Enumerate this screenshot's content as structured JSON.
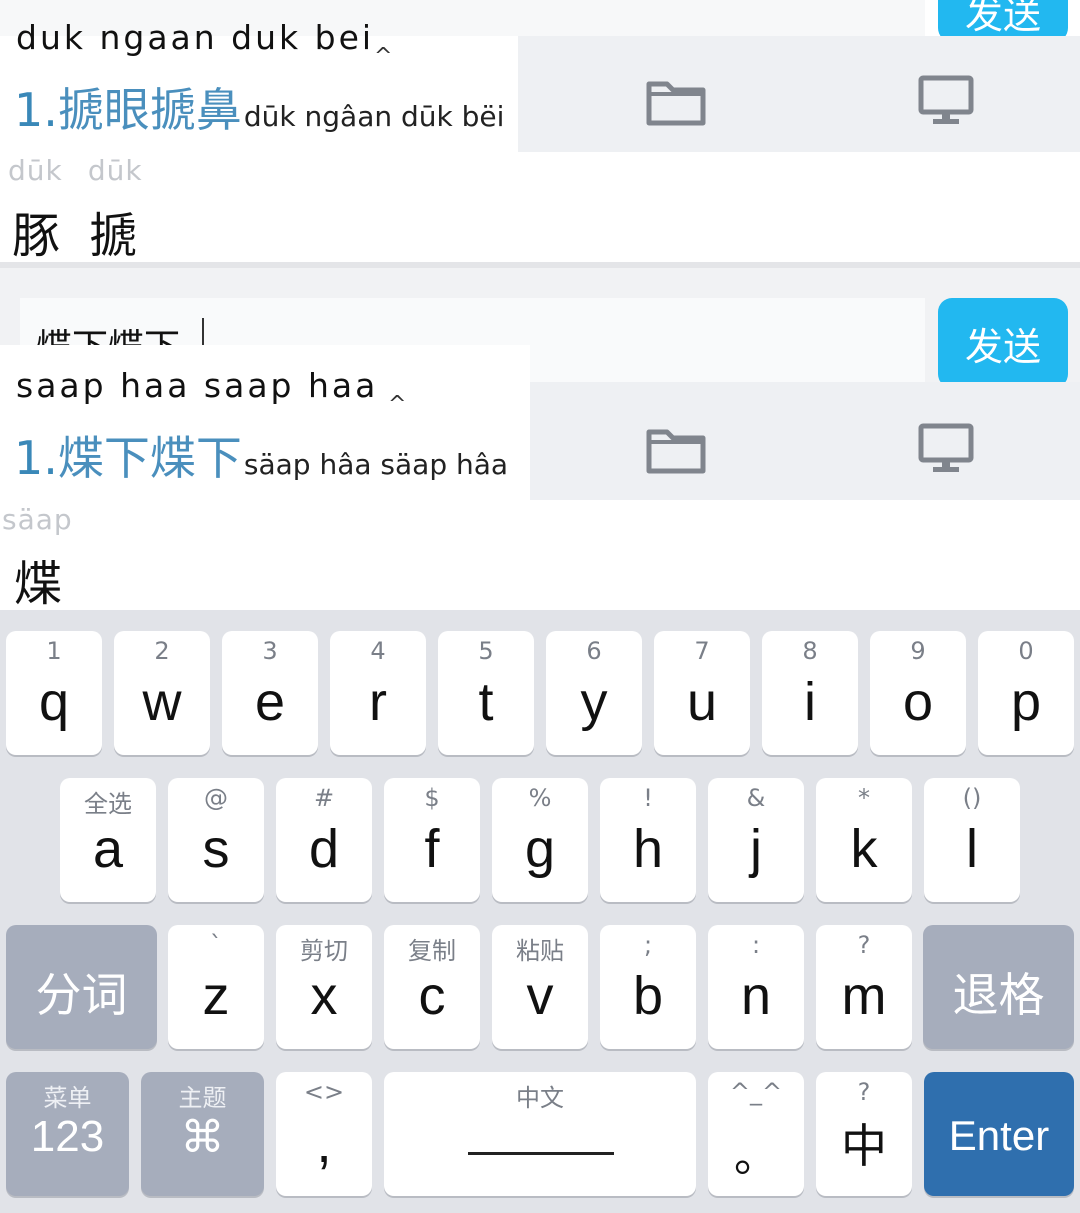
{
  "panel1": {
    "send_label": "发送",
    "composition": "duk ngaan duk bei",
    "caret": "^",
    "candidate_number": "1.",
    "candidate_chars": "搋眼搋鼻",
    "candidate_roman": "dūk ngâan dūk bëi",
    "tones": [
      "dūk",
      "dūk"
    ],
    "chars": [
      "豚",
      "搋"
    ]
  },
  "panel2": {
    "input_text": "煠下煠下",
    "send_label": "发送",
    "composition": "saap haa saap haa",
    "caret": "^",
    "candidate_number": "1.",
    "candidate_chars": "煠下煠下",
    "candidate_roman": "säap hâa säap hâa",
    "tones": [
      "säap"
    ],
    "chars": [
      "煠"
    ]
  },
  "icons": [
    "folder-icon",
    "monitor-icon"
  ],
  "keyboard": {
    "row1": [
      {
        "sec": "1",
        "pri": "q"
      },
      {
        "sec": "2",
        "pri": "w"
      },
      {
        "sec": "3",
        "pri": "e"
      },
      {
        "sec": "4",
        "pri": "r"
      },
      {
        "sec": "5",
        "pri": "t"
      },
      {
        "sec": "6",
        "pri": "y"
      },
      {
        "sec": "7",
        "pri": "u"
      },
      {
        "sec": "8",
        "pri": "i"
      },
      {
        "sec": "9",
        "pri": "o"
      },
      {
        "sec": "0",
        "pri": "p"
      }
    ],
    "row2": [
      {
        "sec": "全选",
        "pri": "a"
      },
      {
        "sec": "@",
        "pri": "s"
      },
      {
        "sec": "#",
        "pri": "d"
      },
      {
        "sec": "$",
        "pri": "f"
      },
      {
        "sec": "%",
        "pri": "g"
      },
      {
        "sec": "!",
        "pri": "h"
      },
      {
        "sec": "&",
        "pri": "j"
      },
      {
        "sec": "*",
        "pri": "k"
      },
      {
        "sec": "()",
        "pri": "l"
      }
    ],
    "row3": {
      "left": "分词",
      "keys": [
        {
          "sec": "`",
          "pri": "z"
        },
        {
          "sec": "剪切",
          "pri": "x"
        },
        {
          "sec": "复制",
          "pri": "c"
        },
        {
          "sec": "粘贴",
          "pri": "v"
        },
        {
          "sec": ";",
          "pri": "b"
        },
        {
          "sec": ":",
          "pri": "n"
        },
        {
          "sec": "?",
          "pri": "m"
        }
      ],
      "right": "退格"
    },
    "row4": {
      "num": {
        "sec": "菜单",
        "pri": "123"
      },
      "theme": {
        "sec": "主题",
        "pri": "⌘"
      },
      "comma": {
        "sec": "<>",
        "pri": ","
      },
      "space": {
        "sec": "中文",
        "pri": ""
      },
      "period": {
        "sec": "^_^",
        "pri": "。"
      },
      "zh": {
        "sec": "?",
        "pri": "中"
      },
      "enter": "Enter"
    }
  },
  "colors": {
    "send": "#22b8f0",
    "candidate": "#4a8fbd",
    "enter": "#2f6fae",
    "dark_key": "#a6adbc"
  }
}
